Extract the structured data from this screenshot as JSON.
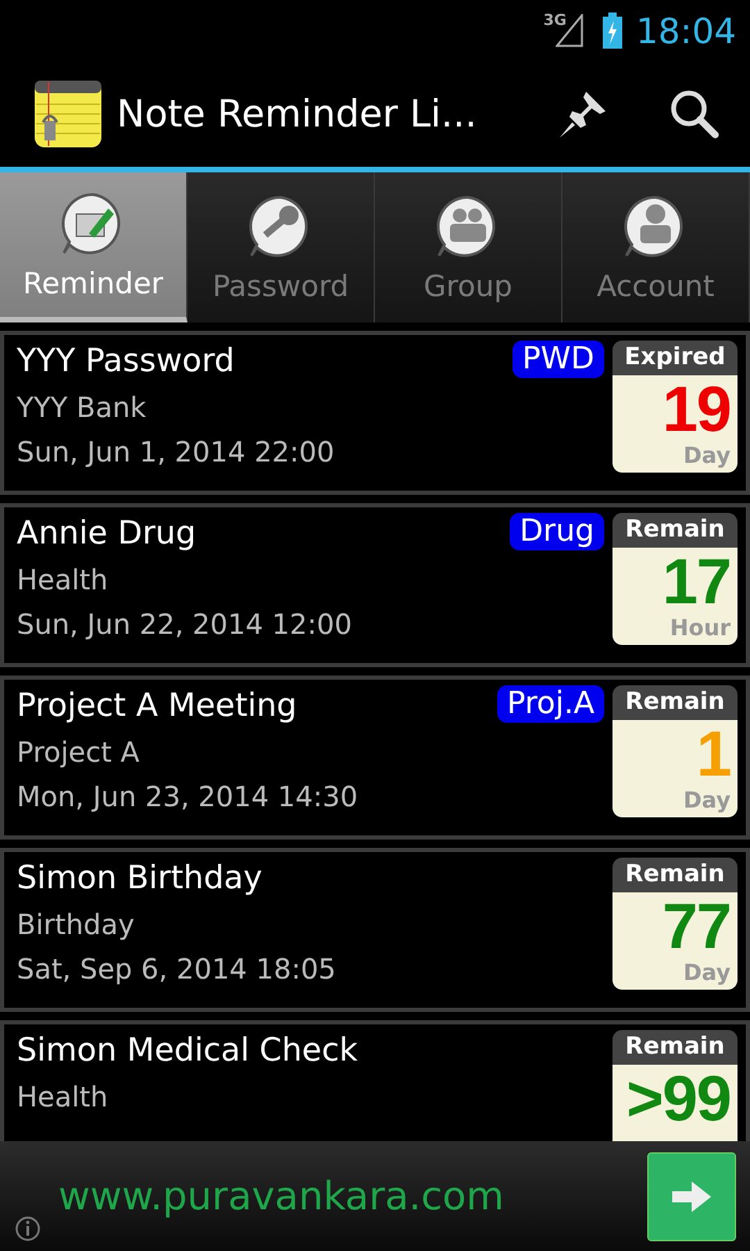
{
  "status_bar": {
    "network": "3G",
    "time": "18:04"
  },
  "action_bar": {
    "title": "Note Reminder Li..."
  },
  "tabs": [
    {
      "label": "Reminder",
      "selected": true,
      "kind": "reminder"
    },
    {
      "label": "Password",
      "selected": false,
      "kind": "password"
    },
    {
      "label": "Group",
      "selected": false,
      "kind": "group"
    },
    {
      "label": "Account",
      "selected": false,
      "kind": "account"
    }
  ],
  "reminders": [
    {
      "title": "YYY Password",
      "category": "YYY Bank",
      "date": "Sun, Jun 1, 2014 22:00",
      "tag": "PWD",
      "status": "Expired",
      "count": "19",
      "unit": "Day",
      "color": "#ee0000"
    },
    {
      "title": "Annie Drug",
      "category": "Health",
      "date": "Sun, Jun 22, 2014 12:00",
      "tag": "Drug",
      "status": "Remain",
      "count": "17",
      "unit": "Hour",
      "color": "#118811"
    },
    {
      "title": "Project A Meeting",
      "category": "Project A",
      "date": "Mon, Jun 23, 2014 14:30",
      "tag": "Proj.A",
      "status": "Remain",
      "count": "1",
      "unit": "Day",
      "color": "#f5a000"
    },
    {
      "title": "Simon Birthday",
      "category": "Birthday",
      "date": "Sat, Sep 6, 2014 18:05",
      "status": "Remain",
      "count": "77",
      "unit": "Day",
      "color": "#118811"
    },
    {
      "title": "Simon Medical Check",
      "category": "Health",
      "status": "Remain",
      "count": ">99",
      "color": "#118811"
    }
  ],
  "ad": {
    "text": "www.puravankara.com"
  }
}
